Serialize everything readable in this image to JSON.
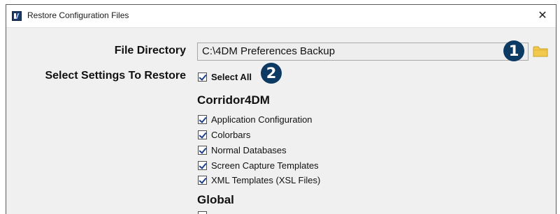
{
  "window": {
    "title": "Restore Configuration Files",
    "close_label": "✕"
  },
  "file_directory": {
    "label": "File Directory",
    "value": "C:\\4DM Preferences Backup"
  },
  "select_settings": {
    "label": "Select Settings To Restore",
    "select_all_label": "Select All",
    "select_all_checked": true
  },
  "callouts": {
    "one": "1",
    "two": "2"
  },
  "sections": [
    {
      "title": "Corridor4DM",
      "items": [
        {
          "label": "Application Configuration",
          "checked": true
        },
        {
          "label": "Colorbars",
          "checked": true
        },
        {
          "label": "Normal Databases",
          "checked": true
        },
        {
          "label": "Screen Capture Templates",
          "checked": true
        },
        {
          "label": "XML Templates (XSL Files)",
          "checked": true
        }
      ]
    },
    {
      "title": "Global",
      "items": []
    }
  ],
  "colors": {
    "callout": "#0d3a63",
    "folder": "#f2c94c"
  }
}
